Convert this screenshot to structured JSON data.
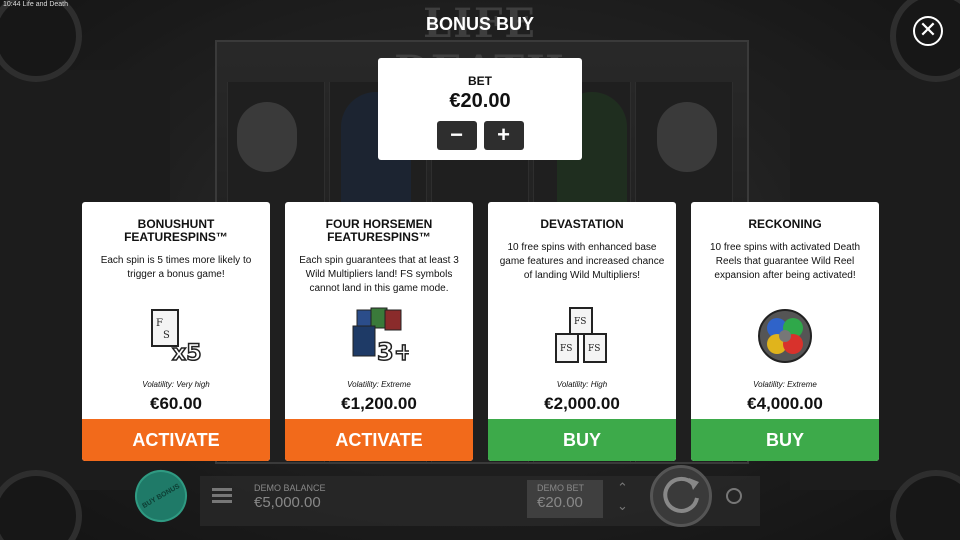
{
  "status_bar": {
    "time": "10:44",
    "app": "Life and Death"
  },
  "logo": {
    "text": "LIFE  DEATH"
  },
  "modal": {
    "title": "BONUS BUY",
    "bet": {
      "label": "BET",
      "value": "€20.00",
      "minus": "−",
      "plus": "+"
    }
  },
  "cards": [
    {
      "title": "BONUSHUNT FEATURESPINS™",
      "description": "Each spin is 5 times more likely to trigger a bonus game!",
      "icon": "fs-x5-icon",
      "volatility": "Volatility: Very high",
      "price": "€60.00",
      "button": "ACTIVATE",
      "button_color": "#f26a1b"
    },
    {
      "title": "FOUR HORSEMEN FEATURESPINS™",
      "description": "Each spin guarantees that at least 3 Wild Multipliers land! FS symbols cannot land in this game mode.",
      "icon": "wild-3plus-icon",
      "volatility": "Volatility: Extreme",
      "price": "€1,200.00",
      "button": "ACTIVATE",
      "button_color": "#f26a1b"
    },
    {
      "title": "DEVASTATION",
      "description": "10 free spins with enhanced base game features and increased chance of landing Wild Multipliers!",
      "icon": "fs-stack-icon",
      "volatility": "Volatility: High",
      "price": "€2,000.00",
      "button": "BUY",
      "button_color": "#3daa4a"
    },
    {
      "title": "RECKONING",
      "description": "10 free spins with activated Death Reels that guarantee Wild Reel expansion after being activated!",
      "icon": "stained-glass-icon",
      "volatility": "Volatility: Extreme",
      "price": "€4,000.00",
      "button": "BUY",
      "button_color": "#3daa4a"
    }
  ],
  "bottom_bar": {
    "buy_bonus": "BUY BONUS",
    "balance_label": "DEMO BALANCE",
    "balance_value": "€5,000.00",
    "bet_label": "DEMO BET",
    "bet_value": "€20.00"
  }
}
